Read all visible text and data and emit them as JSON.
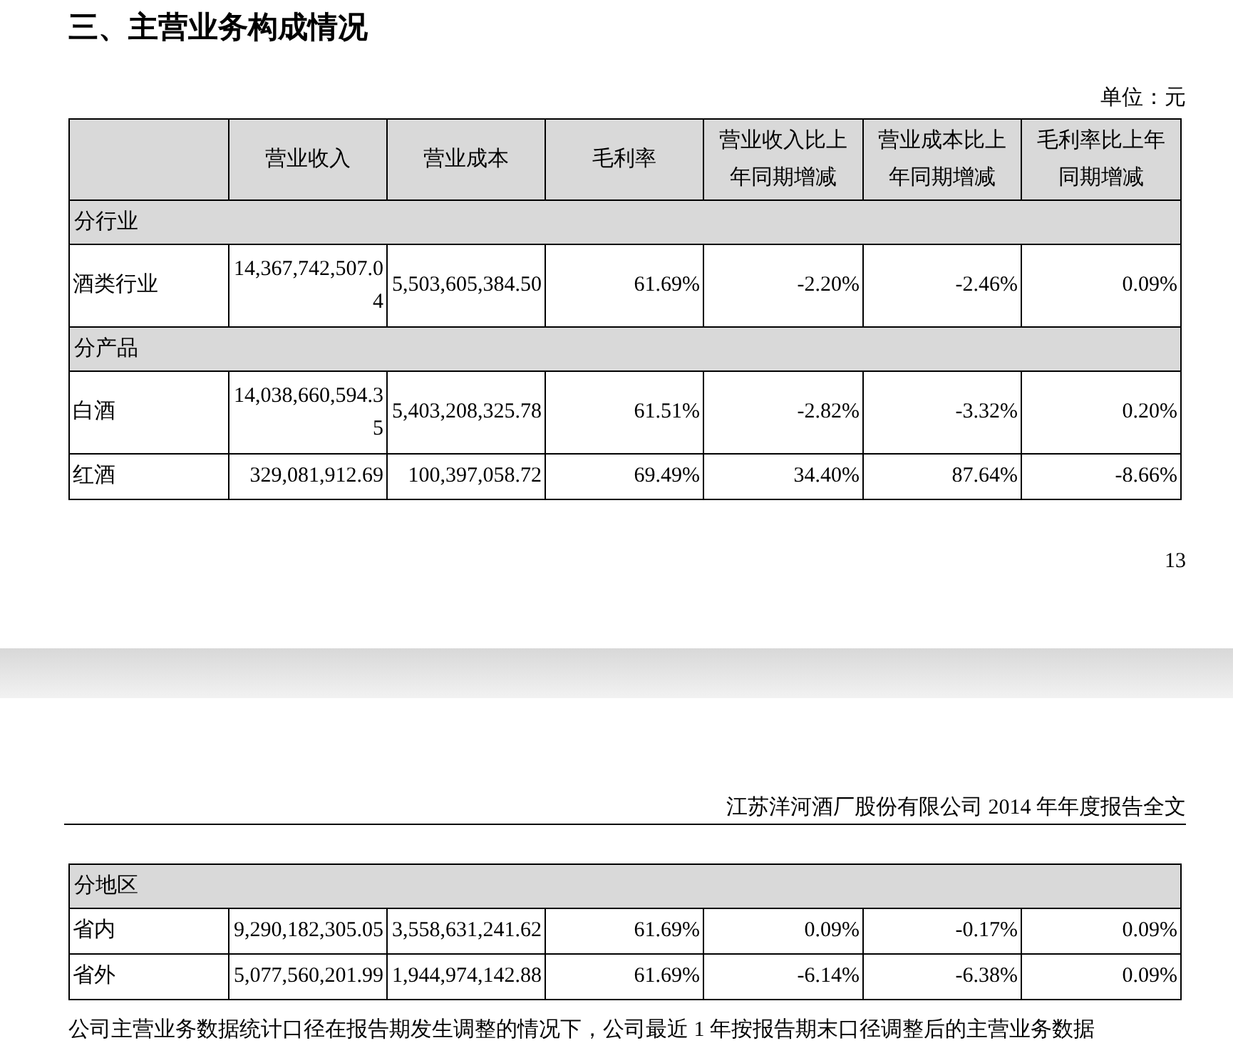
{
  "section_title": "三、主营业务构成情况",
  "unit": "单位：元",
  "table_1": {
    "columns": [
      "",
      "营业收入",
      "营业成本",
      "毛利率",
      "营业收入比上年同期增减",
      "营业成本比上年同期增减",
      "毛利率比上年同期增减"
    ],
    "rows": [
      {
        "kind": "group",
        "label": "分行业"
      },
      {
        "kind": "data",
        "cells": [
          "酒类行业",
          "14,367,742,507.04",
          "5,503,605,384.50",
          "61.69%",
          "-2.20%",
          "-2.46%",
          "0.09%"
        ]
      },
      {
        "kind": "group",
        "label": "分产品"
      },
      {
        "kind": "data",
        "cells": [
          "白酒",
          "14,038,660,594.35",
          "5,403,208,325.78",
          "61.51%",
          "-2.82%",
          "-3.32%",
          "0.20%"
        ]
      },
      {
        "kind": "data",
        "cells": [
          "红酒",
          "329,081,912.69",
          "100,397,058.72",
          "69.49%",
          "34.40%",
          "87.64%",
          "-8.66%"
        ]
      }
    ]
  },
  "page_number": "13",
  "page_header": "江苏洋河酒厂股份有限公司 2014 年年度报告全文",
  "table_2": {
    "rows": [
      {
        "kind": "group",
        "label": "分地区"
      },
      {
        "kind": "data",
        "cells": [
          "省内",
          "9,290,182,305.05",
          "3,558,631,241.62",
          "61.69%",
          "0.09%",
          "-0.17%",
          "0.09%"
        ]
      },
      {
        "kind": "data",
        "cells": [
          "省外",
          "5,077,560,201.99",
          "1,944,974,142.88",
          "61.69%",
          "-6.14%",
          "-6.38%",
          "0.09%"
        ]
      }
    ]
  },
  "footnote": "公司主营业务数据统计口径在报告期发生调整的情况下，公司最近 1 年按报告期末口径调整后的主营业务数据"
}
